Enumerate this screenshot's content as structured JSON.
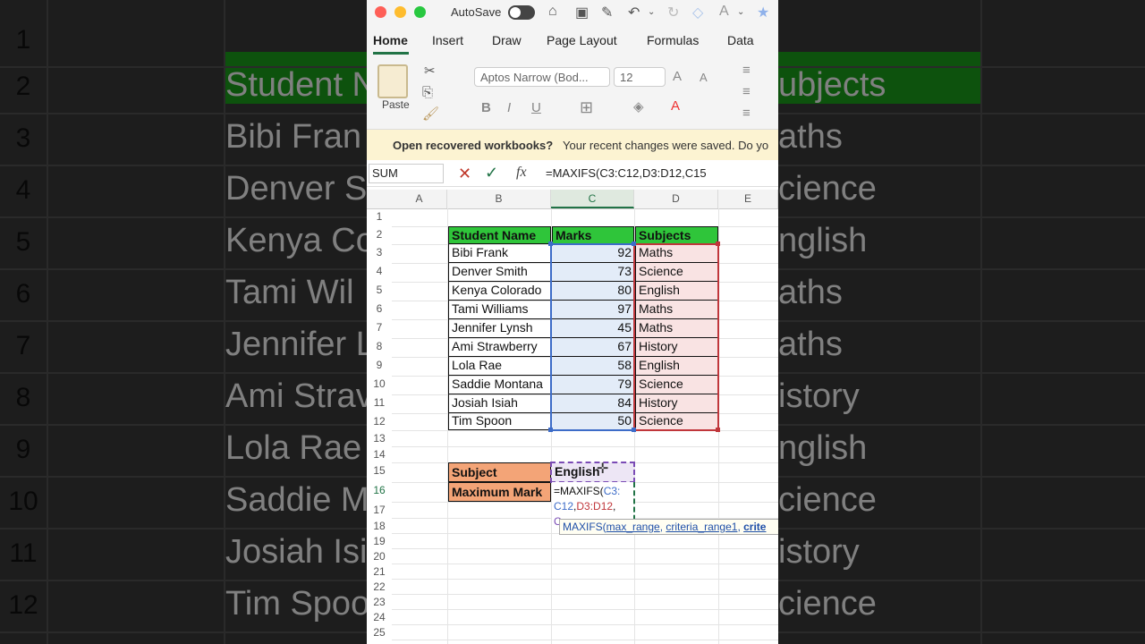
{
  "background": {
    "row_numbers": [
      "1",
      "2",
      "3",
      "4",
      "5",
      "6",
      "7",
      "8",
      "9",
      "10",
      "11",
      "12"
    ],
    "left_texts": [
      "",
      "Student N",
      "Bibi Fran",
      "Denver S",
      "Kenya Co",
      "Tami Wil",
      "Jennifer L",
      "Ami Strav",
      "Lola Rae",
      "Saddie M",
      "Josiah Isi",
      "Tim Spoo"
    ],
    "right_texts": [
      "",
      "ubjects",
      "aths",
      "cience",
      "nglish",
      "aths",
      "aths",
      "istory",
      "nglish",
      "cience",
      "istory",
      "cience"
    ]
  },
  "titlebar": {
    "autosave_label": "AutoSave"
  },
  "tabs": [
    "Home",
    "Insert",
    "Draw",
    "Page Layout",
    "Formulas",
    "Data"
  ],
  "ribbon": {
    "paste_label": "Paste",
    "font_name": "Aptos Narrow (Bod...",
    "font_size": "12"
  },
  "notice": {
    "title": "Open recovered workbooks?",
    "message": "Your recent changes were saved. Do yo"
  },
  "formula_bar": {
    "name_box": "SUM",
    "formula": "=MAXIFS(C3:C12,D3:D12,C15"
  },
  "columns": [
    "A",
    "B",
    "C",
    "D",
    "E"
  ],
  "rows": [
    "1",
    "2",
    "3",
    "4",
    "5",
    "6",
    "7",
    "8",
    "9",
    "10",
    "11",
    "12",
    "13",
    "14",
    "15",
    "16",
    "17",
    "18",
    "19",
    "20",
    "21",
    "22",
    "23",
    "24",
    "25"
  ],
  "table": {
    "headers": [
      "Student Name",
      "Marks",
      "Subjects"
    ],
    "records": [
      {
        "name": "Bibi Frank",
        "mark": "92",
        "subject": "Maths"
      },
      {
        "name": "Denver  Smith",
        "mark": "73",
        "subject": "Science"
      },
      {
        "name": "Kenya Colorado",
        "mark": "80",
        "subject": "English"
      },
      {
        "name": "Tami  Williams",
        "mark": "97",
        "subject": "Maths"
      },
      {
        "name": "Jennifer Lynsh",
        "mark": "45",
        "subject": "Maths"
      },
      {
        "name": "Ami Strawberry",
        "mark": "67",
        "subject": "History"
      },
      {
        "name": "Lola Rae",
        "mark": "58",
        "subject": "English"
      },
      {
        "name": "Saddie Montana",
        "mark": "79",
        "subject": "Science"
      },
      {
        "name": "Josiah Isiah",
        "mark": "84",
        "subject": "History"
      },
      {
        "name": "Tim Spoon",
        "mark": "50",
        "subject": "Science"
      }
    ]
  },
  "criteria": {
    "subject_label": "Subject",
    "subject_value": "English",
    "max_label": "Maximum Mark"
  },
  "edit_cell": {
    "line1_a": "=MAXIFS(",
    "line1_b": "C3:",
    "line2_a": "C12",
    "line2_b": ",",
    "line2_c": "D3:D12",
    "line2_d": ",",
    "line3": "C"
  },
  "tooltip": {
    "fn": "MAXIFS(",
    "arg1": "max_range",
    "sep1": ", ",
    "arg2": "criteria_range1",
    "sep2": ", ",
    "arg3": "crite"
  },
  "colors": {
    "excel_green": "#217346",
    "header_green": "#2fc53a",
    "orange": "#f3a477",
    "blue_range": "#3d6cc8",
    "red_range": "#c0363b"
  }
}
